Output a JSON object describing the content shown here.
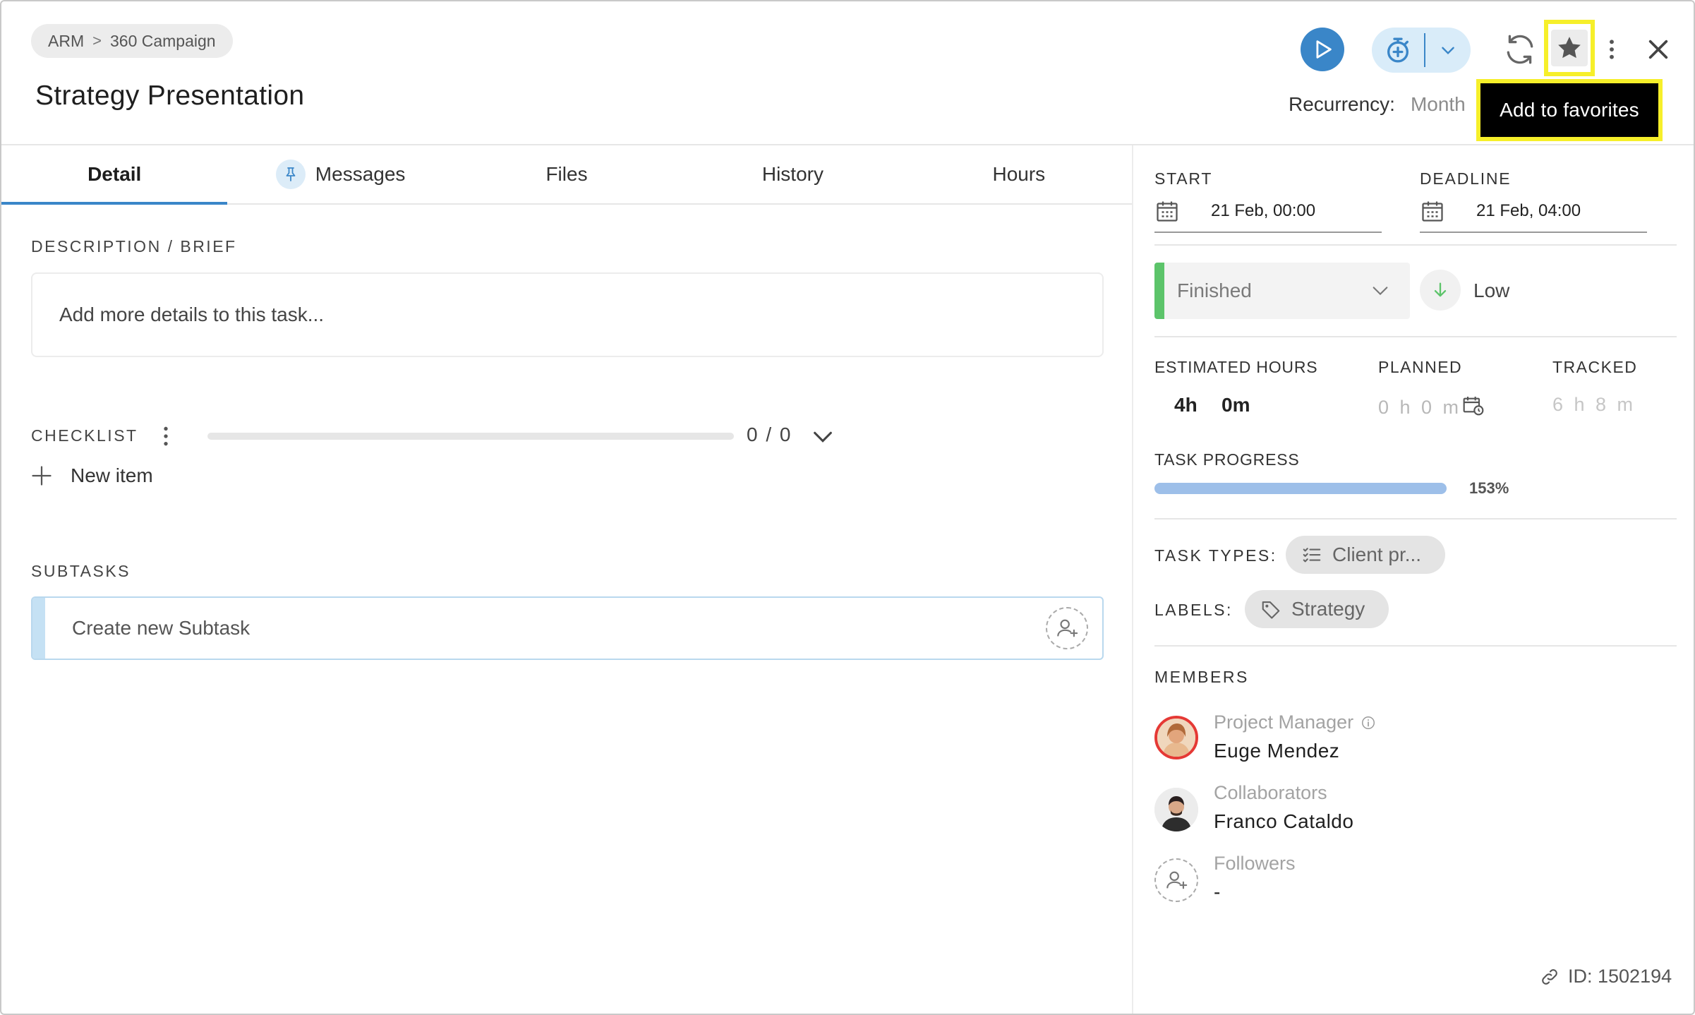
{
  "breadcrumb": {
    "root": "ARM",
    "separator": ">",
    "current": "360 Campaign"
  },
  "task": {
    "title": "Strategy Presentation"
  },
  "toolbar": {
    "play_icon": "play-icon",
    "timer_icon": "stopwatch-add-icon",
    "sync_icon": "sync-icon",
    "favorite_icon": "star-icon",
    "more_icon": "kebab-icon",
    "close_icon": "close-icon"
  },
  "recurrency": {
    "label": "Recurrency:",
    "value": "Month"
  },
  "tooltip": {
    "text": "Add to favorites"
  },
  "tabs": [
    {
      "label": "Detail",
      "active": true
    },
    {
      "label": "Messages",
      "icon": "pin-icon"
    },
    {
      "label": "Files"
    },
    {
      "label": "History"
    },
    {
      "label": "Hours"
    }
  ],
  "description": {
    "label": "DESCRIPTION / BRIEF",
    "placeholder": "Add more details to this task..."
  },
  "checklist": {
    "label": "CHECKLIST",
    "progress": 0,
    "count": "0 / 0",
    "new_item": "New item"
  },
  "subtasks": {
    "label": "SUBTASKS",
    "placeholder": "Create new Subtask"
  },
  "dates": {
    "start_label": "START",
    "start_value": "21 Feb, 00:00",
    "deadline_label": "DEADLINE",
    "deadline_value": "21 Feb, 04:00"
  },
  "status": {
    "value": "Finished",
    "color": "#5cc46a"
  },
  "priority": {
    "value": "Low",
    "color": "#5cc46a"
  },
  "hours": {
    "estimated_label": "ESTIMATED HOURS",
    "estimated_h": "4h",
    "estimated_m": "0m",
    "planned_label": "PLANNED",
    "planned_value": "0 h 0 m",
    "tracked_label": "TRACKED",
    "tracked_value": "6 h 8 m"
  },
  "progress": {
    "label": "TASK PROGRESS",
    "value": "153%",
    "fraction": 1.53
  },
  "task_types": {
    "label": "TASK TYPES:",
    "value": "Client pr..."
  },
  "labels": {
    "label": "LABELS:",
    "value": "Strategy"
  },
  "members": {
    "label": "MEMBERS",
    "pm_role": "Project Manager",
    "pm_name": "Euge Mendez",
    "collab_role": "Collaborators",
    "collab_name": "Franco Cataldo",
    "followers_role": "Followers",
    "followers_name": "-"
  },
  "footer": {
    "id": "ID: 1502194"
  },
  "colors": {
    "accent": "#3a86c8",
    "highlight": "#f6ef2a",
    "tooltip_bg": "#000000"
  }
}
